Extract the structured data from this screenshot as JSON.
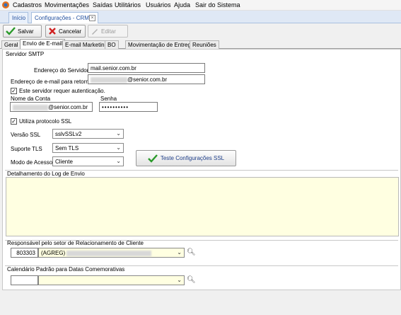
{
  "menu": [
    "Cadastros",
    "Movimentações",
    "Saídas",
    "Utilitários",
    "Usuários",
    "Ajuda",
    "Sair do Sistema"
  ],
  "doctabs": {
    "home": "Início",
    "active": "Configurações - CRM",
    "close": "⊠"
  },
  "toolbar": {
    "save": "Salvar",
    "cancel": "Cancelar",
    "edit": "Editar"
  },
  "pagetabs": [
    "Geral",
    "Envio de E-mail",
    "E-mail Marketing",
    "BO",
    "Movimentação de Entrega",
    "Reuniões"
  ],
  "smtp": {
    "section": "Servidor SMTP",
    "server_label": "Endereço do Servidor",
    "server_value": "mail.senior.com.br",
    "return_label": "Endereço de e-mail para retorno",
    "return_suffix": "@senior.com.br",
    "auth_label": "Este servidor requer autenticação.",
    "account_label": "Nome da Conta",
    "account_suffix": "@senior.com.br",
    "password_label": "Senha",
    "password_value": "••••••••••",
    "ssl_label": "Utiliza protocolo SSL",
    "ssl_version_label": "Versão SSL",
    "ssl_version_value": "sslvSSLv2",
    "tls_label": "Suporte TLS",
    "tls_value": "Sem TLS",
    "mode_label": "Modo de Acesso",
    "mode_value": "Cliente",
    "test_button": "Teste Configurações SSL"
  },
  "log": {
    "section": "Detalhamento do Log de Envio"
  },
  "responsavel": {
    "section": "Responsável pelo setor de Relacionamento de Cliente",
    "code": "803303",
    "prefix": "(AGREG)"
  },
  "calendario": {
    "section": "Calendário Padrão para Datas Comemorativas"
  }
}
